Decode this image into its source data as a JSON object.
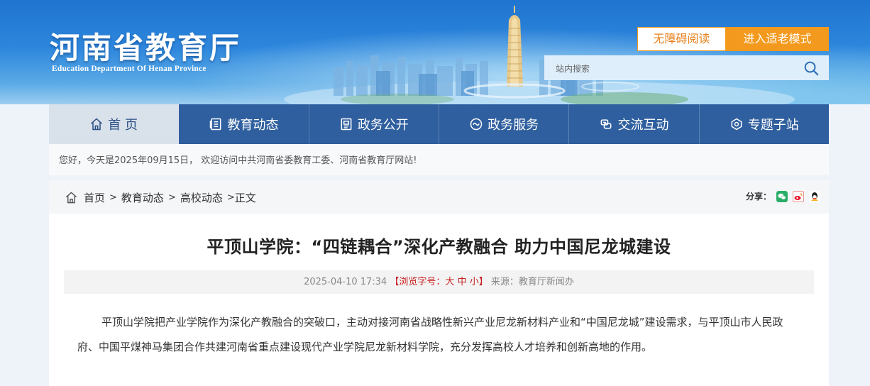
{
  "header": {
    "logo_cn": "河南省教育厅",
    "logo_en": "Education Department Of Henan Province",
    "accessible_label": "无障碍阅读",
    "elder_mode_label": "进入适老模式",
    "search": {
      "placeholder": "站内搜索",
      "icon": "search-icon"
    }
  },
  "nav": {
    "items": [
      {
        "label": "首 页",
        "icon": "home-icon"
      },
      {
        "label": "教育动态",
        "icon": "news-icon"
      },
      {
        "label": "政务公开",
        "icon": "document-icon"
      },
      {
        "label": "政务服务",
        "icon": "service-icon"
      },
      {
        "label": "交流互动",
        "icon": "interaction-icon"
      },
      {
        "label": "专题子站",
        "icon": "topic-icon"
      }
    ]
  },
  "welcome": "您好，今天是2025年09月15日，  欢迎访问中共河南省委教育工委、河南省教育厅网站!",
  "breadcrumb": {
    "home": "首页",
    "level1": "教育动态",
    "level2": "高校动态",
    "current": "正文",
    "sep": ">"
  },
  "share": {
    "label": "分享：",
    "icons": [
      "wechat-icon",
      "weibo-icon",
      "qq-icon"
    ]
  },
  "article": {
    "title": "平顶山学院：“四链耦合”深化产教融合 助力中国尼龙城建设",
    "datetime": "2025-04-10 17:34",
    "font_size_prefix": "【浏览字号：",
    "font_large": "大",
    "font_medium": "中",
    "font_small": "小",
    "font_size_suffix": "】",
    "source": "来源：教育厅新闻办",
    "paragraph": "平顶山学院把产业学院作为深化产教融合的突破口，主动对接河南省战略性新兴产业尼龙新材料产业和“中国尼龙城”建设需求，与平顶山市人民政府、中国平煤神马集团合作共建河南省重点建设现代产业学院尼龙新材料学院，充分发挥高校人才培养和创新高地的作用。"
  },
  "colors": {
    "nav_bg": "#2f5f9e",
    "nav_active_bg": "#d9e1eb",
    "accent_orange": "#f39a1e",
    "font_size_red": "#c81f1f"
  }
}
